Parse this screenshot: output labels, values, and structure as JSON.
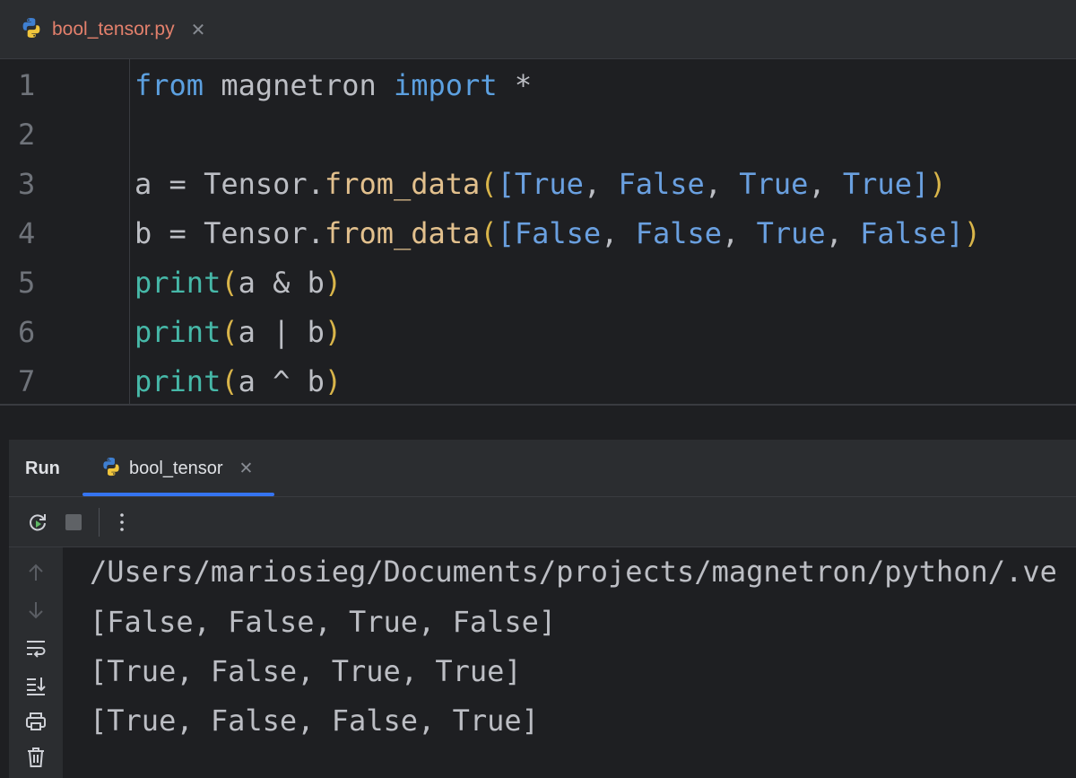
{
  "editor": {
    "tab_filename": "bool_tensor.py",
    "lines": [
      {
        "num": "1"
      },
      {
        "num": "2"
      },
      {
        "num": "3"
      },
      {
        "num": "4"
      },
      {
        "num": "5"
      },
      {
        "num": "6"
      },
      {
        "num": "7"
      }
    ],
    "tokens": {
      "l1": {
        "kw1": "from",
        "mod": " magnetron ",
        "kw2": "import",
        "star": " *"
      },
      "l3": {
        "a": "a = Tensor.",
        "fn": "from_data",
        "p1": "(",
        "b1": "[",
        "v1": "True",
        "c1": ", ",
        "v2": "False",
        "c2": ", ",
        "v3": "True",
        "c3": ", ",
        "v4": "True",
        "b2": "]",
        "p2": ")"
      },
      "l4": {
        "a": "b = Tensor.",
        "fn": "from_data",
        "p1": "(",
        "b1": "[",
        "v1": "False",
        "c1": ", ",
        "v2": "False",
        "c2": ", ",
        "v3": "True",
        "c3": ", ",
        "v4": "False",
        "b2": "]",
        "p2": ")"
      },
      "l5": {
        "fn": "print",
        "p1": "(",
        "expr": "a & b",
        "p2": ")"
      },
      "l6": {
        "fn": "print",
        "p1": "(",
        "expr": "a | b",
        "p2": ")"
      },
      "l7": {
        "fn": "print",
        "p1": "(",
        "expr": "a ^ b",
        "p2": ")"
      }
    }
  },
  "run": {
    "title": "Run",
    "tab_label": "bool_tensor",
    "output": [
      "/Users/mariosieg/Documents/projects/magnetron/python/.ve",
      "[False, False, True, False]",
      "[True, False, True, True]",
      "[True, False, False, True]"
    ]
  },
  "icons": {
    "file_icon": "python-icon",
    "rerun": "rerun-icon",
    "stop": "stop-icon",
    "more": "more-vertical-icon",
    "up": "arrow-up-icon",
    "down": "arrow-down-icon",
    "wrap": "soft-wrap-icon",
    "scroll_end": "scroll-to-end-icon",
    "print": "print-icon",
    "trash": "trash-icon"
  },
  "colors": {
    "background": "#1e1f22",
    "panel": "#2b2d30",
    "keyword": "#5ca0e0",
    "method": "#e2c08d",
    "builtin": "#46b8a8",
    "paren": "#d9b54a",
    "tab_accent": "#3574f0",
    "filename": "#e3806c"
  }
}
